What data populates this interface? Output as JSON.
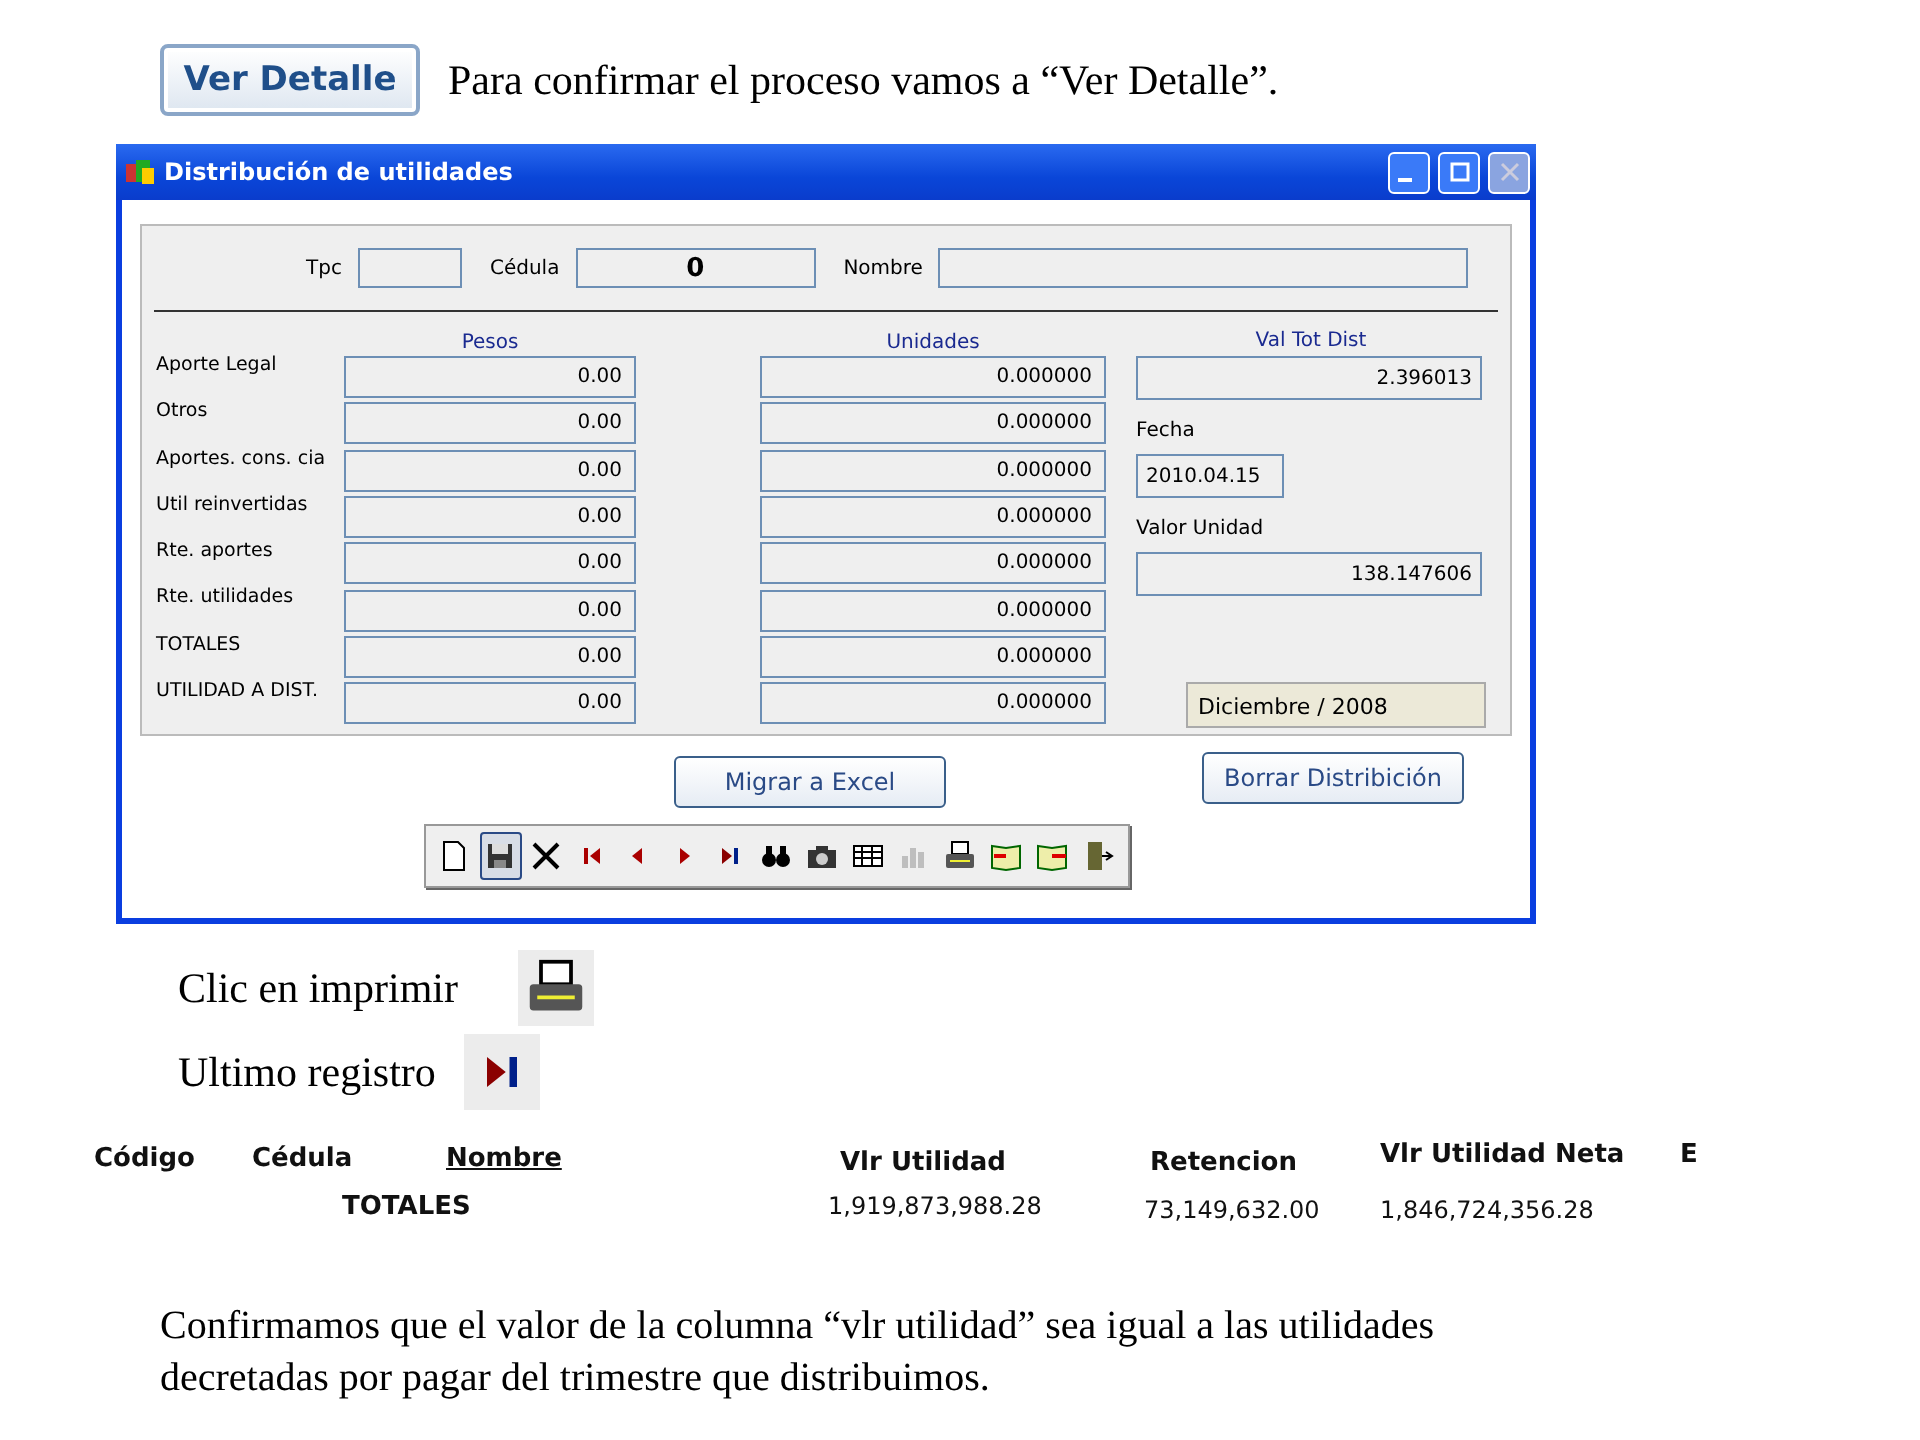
{
  "intro": {
    "button": "Ver Detalle",
    "text": "Para confirmar el proceso vamos a “Ver Detalle”."
  },
  "window": {
    "title": "Distribución de utilidades",
    "header_fields": [
      {
        "label": "Tpc",
        "kind": "short"
      },
      {
        "label": "Cédula",
        "value": "0",
        "kind": "medium"
      },
      {
        "label": "Nombre",
        "kind": "long"
      }
    ],
    "columns": [
      "Pesos",
      "Unidades"
    ],
    "rows": [
      {
        "label": "Aporte Legal",
        "pesos": "0.00",
        "unidades": "0.000000"
      },
      {
        "label": "Otros",
        "pesos": "0.00",
        "unidades": "0.000000"
      },
      {
        "label": "Aportes. cons. cia",
        "pesos": "0.00",
        "unidades": "0.000000"
      },
      {
        "label": "Util reinvertidas",
        "pesos": "0.00",
        "unidades": "0.000000"
      },
      {
        "label": "Rte. aportes",
        "pesos": "0.00",
        "unidades": "0.000000"
      },
      {
        "label": "Rte. utilidades",
        "pesos": "0.00",
        "unidades": "0.000000"
      },
      {
        "label": "TOTALES",
        "pesos": "0.00",
        "unidades": "0.000000"
      },
      {
        "label": "UTILIDAD A DIST.",
        "pesos": "0.00",
        "unidades": "0.000000"
      }
    ],
    "side": [
      {
        "label": "Val Tot Dist",
        "value": "2.396013",
        "kind": "heading"
      },
      {
        "label": "Fecha",
        "value": "2010.04.15",
        "kind": "date"
      },
      {
        "label": "Valor Unidad",
        "value": "138.147606",
        "kind": "number"
      }
    ],
    "period": "Diciembre / 2008",
    "buttons": [
      "Migrar a Excel",
      "Borrar Distribición"
    ],
    "toolbar": [
      {
        "kind": "new",
        "disabled": false,
        "selected": false
      },
      {
        "kind": "save",
        "disabled": false,
        "selected": true
      },
      {
        "kind": "delete",
        "disabled": false,
        "selected": false
      },
      {
        "kind": "first",
        "disabled": false,
        "selected": false
      },
      {
        "kind": "prev",
        "disabled": false,
        "selected": false
      },
      {
        "kind": "next",
        "disabled": false,
        "selected": false
      },
      {
        "kind": "last",
        "disabled": false,
        "selected": false
      },
      {
        "kind": "find",
        "disabled": false,
        "selected": false
      },
      {
        "kind": "camera",
        "disabled": false,
        "selected": false
      },
      {
        "kind": "grid",
        "disabled": false,
        "selected": false
      },
      {
        "kind": "chart",
        "disabled": true,
        "selected": false
      },
      {
        "kind": "print",
        "disabled": false,
        "selected": false
      },
      {
        "kind": "import",
        "disabled": false,
        "selected": false
      },
      {
        "kind": "export",
        "disabled": false,
        "selected": false
      },
      {
        "kind": "exit",
        "disabled": false,
        "selected": false
      }
    ]
  },
  "steps": [
    {
      "text": "Clic en imprimir",
      "kind": "print"
    },
    {
      "text": "Ultimo registro",
      "kind": "last"
    }
  ],
  "report": {
    "columns": [
      {
        "label": "Código",
        "underlined": false
      },
      {
        "label": "Cédula",
        "underlined": false
      },
      {
        "label": "Nombre",
        "underlined": true
      },
      {
        "label": "Vlr Utilidad",
        "underlined": false
      },
      {
        "label": "Retencion",
        "underlined": false
      },
      {
        "label": "Vlr Utilidad Neta",
        "underlined": false
      },
      {
        "label": "E",
        "underlined": false
      }
    ],
    "totals_label": "TOTALES",
    "totals": [
      "1,919,873,988.28",
      "73,149,632.00",
      "1,846,724,356.28"
    ]
  },
  "note": "Confirmamos que el valor de la columna “vlr utilidad” sea igual a las utilidades decretadas por pagar del trimestre que distribuimos."
}
